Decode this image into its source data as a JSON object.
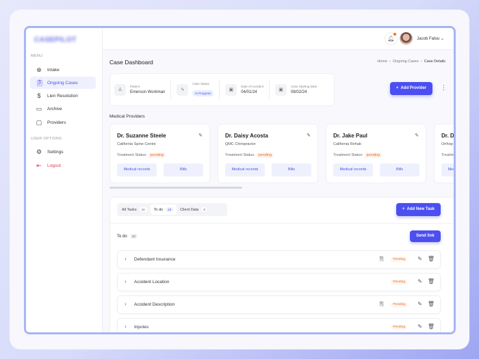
{
  "sidebar": {
    "logo": "CASEPILOT",
    "menu_label": "MENU",
    "items": [
      {
        "label": "Intake",
        "icon": "target-icon"
      },
      {
        "label": "Ongoing Cases",
        "icon": "clipboard-icon"
      },
      {
        "label": "Lien Resolution",
        "icon": "money-hand-icon"
      },
      {
        "label": "Archive",
        "icon": "archive-icon"
      },
      {
        "label": "Providers",
        "icon": "folder-user-icon"
      }
    ],
    "user_options_label": "USER OPTIONS",
    "settings": "Settings",
    "logout": "Logout"
  },
  "topbar": {
    "user_name": "Jacob Fatou"
  },
  "page": {
    "title": "Case Dashboard",
    "breadcrumb": [
      "Home",
      "Ongoing Cases",
      "Case Details"
    ]
  },
  "info": {
    "patient_label": "Patient",
    "patient": "Emerson Workman",
    "status_label": "Case Status",
    "status": "In Progress",
    "accident_label": "Date of Accident",
    "accident": "04/01/24",
    "start_label": "Case Starting Date",
    "start": "08/02/24"
  },
  "add_provider": "Add Provider",
  "providers_title": "Medical Providers",
  "treatment_label": "Treatment Status:",
  "providers": [
    {
      "name": "Dr. Suzanne Steele",
      "org": "California Spine Centre",
      "status": "pending"
    },
    {
      "name": "Dr. Daisy Acosta",
      "org": "QMC Chiropractor",
      "status": "pending"
    },
    {
      "name": "Dr. Jake Paul",
      "org": "California Rehab",
      "status": "pending"
    },
    {
      "name": "Dr. D",
      "org": "Orthop",
      "status": ""
    }
  ],
  "card_buttons": {
    "records": "Medical records",
    "bills": "Bills"
  },
  "tasks": {
    "tabs": [
      {
        "label": "All Tasks",
        "count": "18"
      },
      {
        "label": "To do",
        "count": "10"
      },
      {
        "label": "Client Data",
        "count": "8"
      }
    ],
    "add_task": "Add New Task",
    "section": "To do",
    "section_count": "10",
    "send_link": "Send link",
    "rows": [
      {
        "label": "Defendant Insurance",
        "status": "Pending"
      },
      {
        "label": "Accident Location",
        "status": "Pending"
      },
      {
        "label": "Accident Description",
        "status": "Pending"
      },
      {
        "label": "Injuries",
        "status": "Pending"
      }
    ]
  },
  "colors": {
    "accent": "#4c4ff0",
    "pending": "#e66a2c",
    "logout": "#e23a4b"
  }
}
